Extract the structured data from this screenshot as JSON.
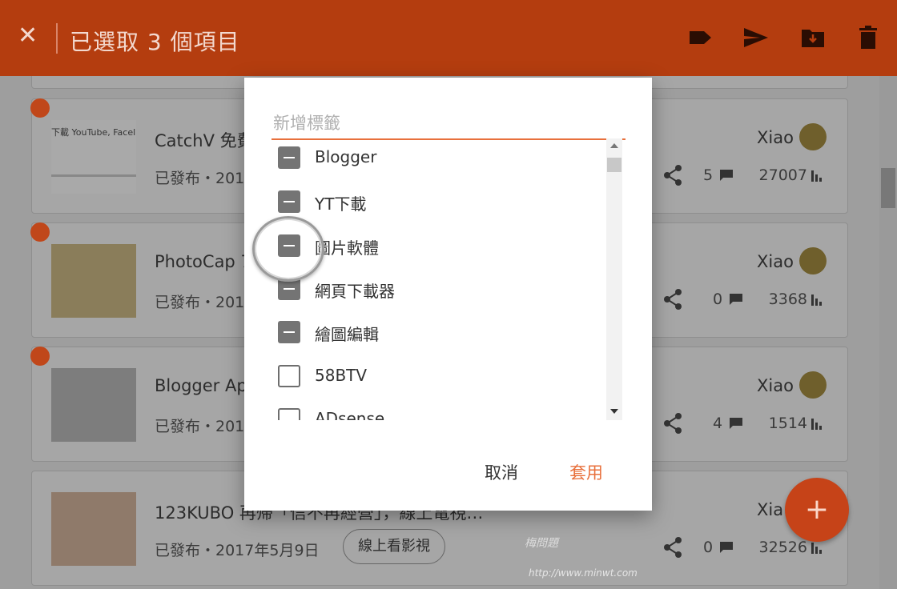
{
  "topbar": {
    "title": "已選取 3 個項目",
    "icons": [
      "close-icon",
      "label-icon",
      "send-icon",
      "move-to-folder-icon",
      "delete-icon"
    ]
  },
  "posts": [
    {
      "title": "CatchV 免費",
      "status": "已發布・201",
      "author": "Xiao",
      "comments": "5",
      "views": "27007",
      "selected": true,
      "thumb_text": "下載 YouTube, Facel 線上影片"
    },
    {
      "title": "PhotoCap 7",
      "status": "已發布・201",
      "author": "Xiao",
      "comments": "0",
      "views": "3368",
      "selected": true
    },
    {
      "title": "Blogger Ap",
      "status": "已發布・201",
      "author": "Xiao",
      "comments": "4",
      "views": "1514",
      "selected": true
    },
    {
      "title": "123KUBO 再帰「信不再經營」，線上電視…",
      "status": "已發布・2017年5月9日",
      "label": "線上看影視",
      "author": "Xia",
      "comments": "0",
      "views": "32526",
      "selected": false
    }
  ],
  "dialog": {
    "placeholder": "新增標籤",
    "labels": [
      {
        "name": "Blogger",
        "state": "indeterminate"
      },
      {
        "name": "YT下載",
        "state": "indeterminate"
      },
      {
        "name": "圖片軟體",
        "state": "indeterminate"
      },
      {
        "name": "網頁下載器",
        "state": "indeterminate"
      },
      {
        "name": "繪圖編輯",
        "state": "indeterminate"
      },
      {
        "name": "58BTV",
        "state": "unchecked"
      },
      {
        "name": "ADsense",
        "state": "unchecked"
      }
    ],
    "cancel_label": "取消",
    "apply_label": "套用"
  },
  "fab": {
    "label": "+"
  },
  "watermark": {
    "url": "http://www.minwt.com"
  },
  "colors": {
    "accent": "#e8703c",
    "topbar": "#b43d0f",
    "fab": "#c64318"
  }
}
